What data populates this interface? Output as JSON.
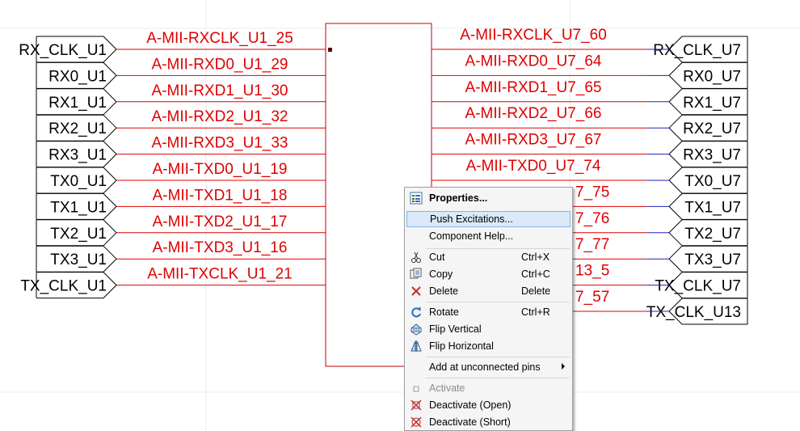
{
  "left_ports": [
    "RX_CLK_U1",
    "RX0_U1",
    "RX1_U1",
    "RX2_U1",
    "RX3_U1",
    "TX0_U1",
    "TX1_U1",
    "TX2_U1",
    "TX3_U1",
    "TX_CLK_U1"
  ],
  "left_nets": [
    "A-MII-RXCLK_U1_25",
    "A-MII-RXD0_U1_29",
    "A-MII-RXD1_U1_30",
    "A-MII-RXD2_U1_32",
    "A-MII-RXD3_U1_33",
    "A-MII-TXD0_U1_19",
    "A-MII-TXD1_U1_18",
    "A-MII-TXD2_U1_17",
    "A-MII-TXD3_U1_16",
    "A-MII-TXCLK_U1_21"
  ],
  "right_ports": [
    "RX_CLK_U7",
    "RX0_U7",
    "RX1_U7",
    "RX2_U7",
    "RX3_U7",
    "TX0_U7",
    "TX1_U7",
    "TX2_U7",
    "TX3_U7",
    "TX_CLK_U7",
    "TX_CLK_U13"
  ],
  "right_nets_visible": [
    "A-MII-RXCLK_U7_60",
    "A-MII-RXD0_U7_64",
    "A-MII-RXD1_U7_65",
    "A-MII-RXD2_U7_66",
    "A-MII-RXD3_U7_67",
    "A-MII-TXD0_U7_74"
  ],
  "right_nets_partial": [
    "7_75",
    "7_76",
    "7_77",
    "13_5",
    "7_57"
  ],
  "context_menu": {
    "properties": "Properties...",
    "push_excitations": "Push Excitations...",
    "component_help": "Component Help...",
    "cut": "Cut",
    "cut_shortcut": "Ctrl+X",
    "copy": "Copy",
    "copy_shortcut": "Ctrl+C",
    "delete": "Delete",
    "delete_shortcut": "Delete",
    "rotate": "Rotate",
    "rotate_shortcut": "Ctrl+R",
    "flip_vertical": "Flip Vertical",
    "flip_horizontal": "Flip Horizontal",
    "add_unconnected": "Add at unconnected pins",
    "activate": "Activate",
    "deactivate_open": "Deactivate (Open)",
    "deactivate_short": "Deactivate (Short)"
  },
  "colors": {
    "wire": "#e00000",
    "bus_blue": "#2020c0",
    "grid": "#e6e6e6",
    "highlight": "#dbe9f8"
  }
}
